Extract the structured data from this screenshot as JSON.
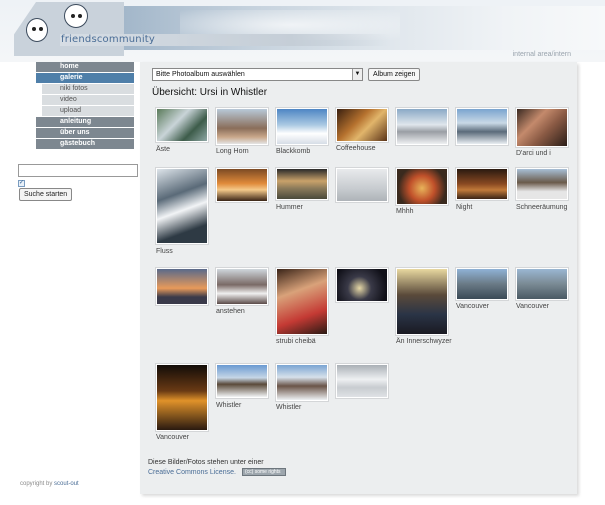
{
  "header": {
    "logo_text": "friendscommunity",
    "internal_link": "internal area/intern"
  },
  "nav": {
    "items": [
      {
        "label": "home",
        "active": false,
        "sub": false
      },
      {
        "label": "galerie",
        "active": true,
        "sub": false
      },
      {
        "label": "niki fotos",
        "active": false,
        "sub": true
      },
      {
        "label": "video",
        "active": false,
        "sub": true
      },
      {
        "label": "upload",
        "active": false,
        "sub": true
      },
      {
        "label": "anleitung",
        "active": false,
        "sub": false
      },
      {
        "label": "über uns",
        "active": false,
        "sub": false
      },
      {
        "label": "gästebuch",
        "active": false,
        "sub": false
      }
    ]
  },
  "search": {
    "input_value": "",
    "button_label": "Suche starten"
  },
  "footer": {
    "copyright_prefix": "copyright by",
    "copyright_link": "scout-out"
  },
  "main": {
    "album_select_value": "Bitte Photoalbum auswählen",
    "album_button_label": "Album zeigen",
    "overview_title": "Übersicht: Ursi in Whistler",
    "photos": [
      {
        "caption": "Äste"
      },
      {
        "caption": "Long Horn"
      },
      {
        "caption": "Blackkomb"
      },
      {
        "caption": "Coffeehouse"
      },
      {
        "caption": ""
      },
      {
        "caption": ""
      },
      {
        "caption": "D'arci und i"
      },
      {
        "caption": "Fluss"
      },
      {
        "caption": ""
      },
      {
        "caption": "Hummer"
      },
      {
        "caption": ""
      },
      {
        "caption": "Mhhh"
      },
      {
        "caption": "Night"
      },
      {
        "caption": "Schneeräumung"
      },
      {
        "caption": ""
      },
      {
        "caption": "anstehen"
      },
      {
        "caption": "strubi cheibä"
      },
      {
        "caption": ""
      },
      {
        "caption": "Än Innerschwyzer"
      },
      {
        "caption": "Vancouver"
      },
      {
        "caption": "Vancouver"
      },
      {
        "caption": "Vancouver"
      },
      {
        "caption": "Whistler"
      },
      {
        "caption": "Whistler"
      },
      {
        "caption": ""
      }
    ],
    "license_text": "Diese Bilder/Fotos stehen unter einer",
    "license_link": "Creative Commons License.",
    "cc_badge": "(cc) some rights"
  }
}
